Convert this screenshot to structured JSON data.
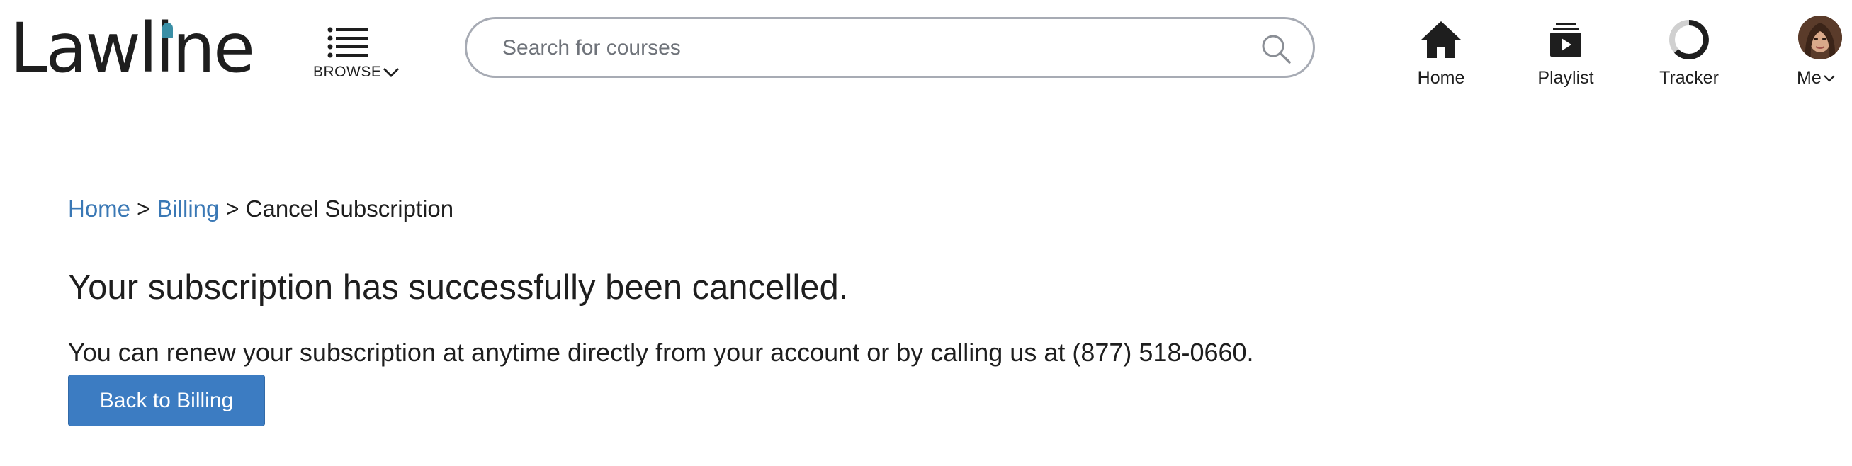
{
  "header": {
    "logo_text": "Lawline",
    "browse_label": "BROWSE",
    "search": {
      "placeholder": "Search for courses",
      "value": ""
    },
    "nav": [
      {
        "label": "Home",
        "icon": "home-icon"
      },
      {
        "label": "Playlist",
        "icon": "playlist-icon"
      },
      {
        "label": "Tracker",
        "icon": "tracker-icon"
      }
    ],
    "me_label": "Me"
  },
  "breadcrumb": {
    "home": "Home",
    "separator": ">",
    "billing": "Billing",
    "current": "Cancel Subscription"
  },
  "main": {
    "title": "Your subscription has successfully been cancelled.",
    "message": "You can renew your subscription at anytime directly from your account or by calling us at (877) 518-0660.",
    "back_button": "Back to Billing"
  },
  "colors": {
    "link": "#3a78b5",
    "button": "#3c7cc2",
    "logo_accent": "#3a8fa6",
    "text": "#1e1e1e"
  }
}
